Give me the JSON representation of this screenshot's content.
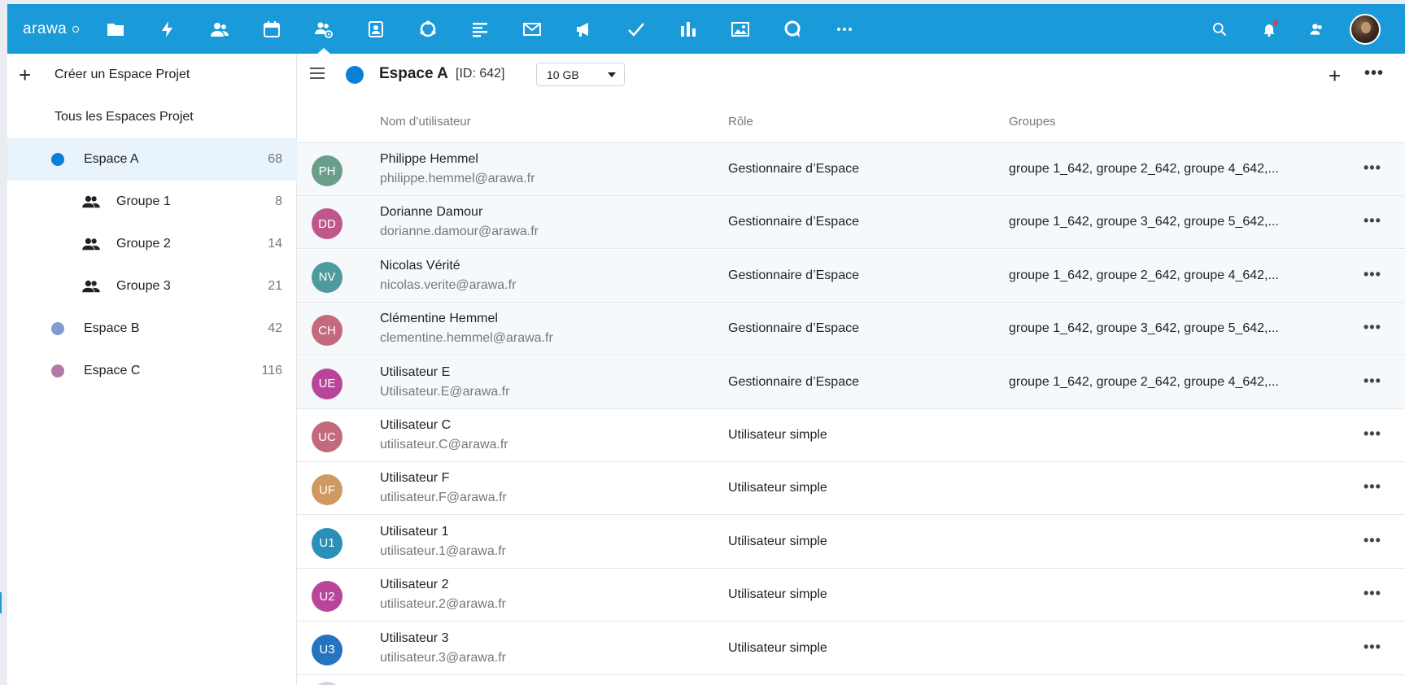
{
  "header": {
    "logo_text": "arawa",
    "brand_color": "#1a9ad9",
    "apps": [
      {
        "name": "files-icon"
      },
      {
        "name": "activity-icon"
      },
      {
        "name": "contacts-icon"
      },
      {
        "name": "calendar-icon"
      },
      {
        "name": "workspace-admin-icon",
        "active": true
      },
      {
        "name": "address-book-icon"
      },
      {
        "name": "sync-icon"
      },
      {
        "name": "text-lines-icon"
      },
      {
        "name": "mail-icon"
      },
      {
        "name": "announcement-icon"
      },
      {
        "name": "tasks-check-icon"
      },
      {
        "name": "stats-bars-icon"
      },
      {
        "name": "photos-icon"
      },
      {
        "name": "talk-icon"
      },
      {
        "name": "more-apps-icon"
      }
    ]
  },
  "sidebar": {
    "create_label": "Créer un Espace Projet",
    "all_label": "Tous les Espaces Projet",
    "spaces": [
      {
        "label": "Espace A",
        "count": "68",
        "color": "#0a7fd6",
        "selected": true
      },
      {
        "label": "Espace B",
        "count": "42",
        "color": "#7f9dd3"
      },
      {
        "label": "Espace C",
        "count": "116",
        "color": "#b47aa6"
      }
    ],
    "groups": [
      {
        "label": "Groupe 1",
        "count": "8"
      },
      {
        "label": "Groupe 2",
        "count": "14"
      },
      {
        "label": "Groupe 3",
        "count": "21"
      }
    ]
  },
  "toolbar": {
    "space_name": "Espace A",
    "space_id": "[ID: 642]",
    "quota": "10 GB",
    "space_color": "#0a7fd6"
  },
  "table": {
    "headers": {
      "name": "Nom d’utilisateur",
      "role": "Rôle",
      "groups": "Groupes"
    },
    "rows": [
      {
        "initials": "PH",
        "color": "#6a9e8a",
        "name": "Philippe Hemmel",
        "email": "philippe.hemmel@arawa.fr",
        "role": "Gestionnaire d’Espace",
        "groups": "groupe 1_642, groupe 2_642, groupe 4_642,...",
        "manager": true
      },
      {
        "initials": "DD",
        "color": "#c0578c",
        "name": "Dorianne Damour",
        "email": "dorianne.damour@arawa.fr",
        "role": "Gestionnaire d’Espace",
        "groups": "groupe 1_642, groupe 3_642, groupe 5_642,...",
        "manager": true
      },
      {
        "initials": "NV",
        "color": "#4f9a9e",
        "name": "Nicolas Vérité",
        "email": "nicolas.verite@arawa.fr",
        "role": "Gestionnaire d’Espace",
        "groups": "groupe 1_642, groupe 2_642, groupe 4_642,...",
        "manager": true
      },
      {
        "initials": "CH",
        "color": "#c46a7c",
        "name": "Clémentine Hemmel",
        "email": "clementine.hemmel@arawa.fr",
        "role": "Gestionnaire d’Espace",
        "groups": "groupe 1_642, groupe 3_642, groupe 5_642,...",
        "manager": true
      },
      {
        "initials": "UE",
        "color": "#b8459a",
        "name": "Utilisateur E",
        "email": "Utilisateur.E@arawa.fr",
        "role": "Gestionnaire d’Espace",
        "groups": "groupe 1_642, groupe 2_642, groupe 4_642,...",
        "manager": true
      },
      {
        "initials": "UC",
        "color": "#c46a7c",
        "name": "Utilisateur C",
        "email": "utilisateur.C@arawa.fr",
        "role": "Utilisateur simple",
        "groups": "",
        "manager": false
      },
      {
        "initials": "UF",
        "color": "#cf9a62",
        "name": "Utilisateur F",
        "email": "utilisateur.F@arawa.fr",
        "role": "Utilisateur simple",
        "groups": "",
        "manager": false
      },
      {
        "initials": "U1",
        "color": "#2c8fb8",
        "name": "Utilisateur 1",
        "email": "utilisateur.1@arawa.fr",
        "role": "Utilisateur simple",
        "groups": "",
        "manager": false
      },
      {
        "initials": "U2",
        "color": "#b8459a",
        "name": "Utilisateur 2",
        "email": "utilisateur.2@arawa.fr",
        "role": "Utilisateur simple",
        "groups": "",
        "manager": false
      },
      {
        "initials": "U3",
        "color": "#2673c2",
        "name": "Utilisateur 3",
        "email": "utilisateur.3@arawa.fr",
        "role": "Utilisateur simple",
        "groups": "",
        "manager": false
      }
    ]
  }
}
